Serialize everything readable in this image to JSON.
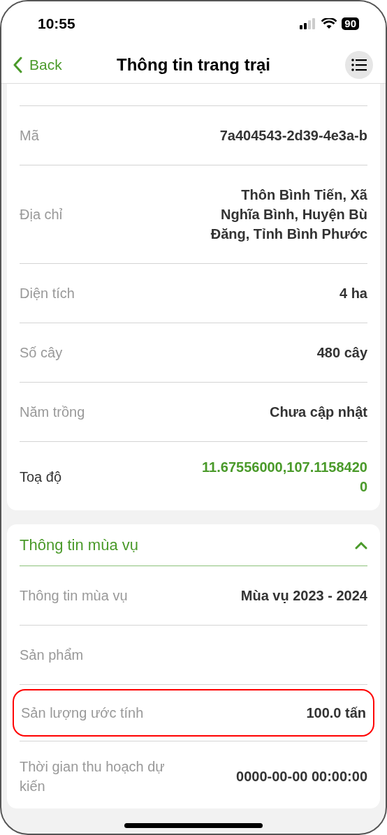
{
  "status_bar": {
    "time": "10:55",
    "battery": "90"
  },
  "nav": {
    "back": "Back",
    "title": "Thông tin trang trại"
  },
  "farm_rows": [
    {
      "kind": "plain",
      "label": "Mã",
      "value": "7a404543-2d39-4e3a-b"
    },
    {
      "kind": "plain",
      "label": "Địa chỉ",
      "value": "Thôn Bình Tiến, Xã Nghĩa Bình, Huyện Bù Đăng, Tỉnh Bình Phước"
    },
    {
      "kind": "plain",
      "label": "Diện tích",
      "value": "4 ha"
    },
    {
      "kind": "plain",
      "label": "Số cây",
      "value": "480  cây"
    },
    {
      "kind": "plain",
      "label": "Năm trồng",
      "value": "Chưa cập nhật"
    },
    {
      "kind": "link",
      "label": "Toạ độ",
      "value": "11.67556000,107.11584200"
    }
  ],
  "season": {
    "title": "Thông tin mùa vụ",
    "expanded": true,
    "rows": [
      {
        "label": "Thông tin mùa vụ",
        "value": "Mùa vụ 2023 - 2024",
        "highlighted": false
      },
      {
        "label": "Sản phẩm",
        "highlighted": false
      },
      {
        "label": "Sản lượng ước tính",
        "value": "100.0 tấn",
        "highlighted": true
      },
      {
        "label": "Thời gian thu hoạch dự kiến",
        "value": "0000-00-00 00:00:00",
        "highlighted": false
      }
    ]
  }
}
